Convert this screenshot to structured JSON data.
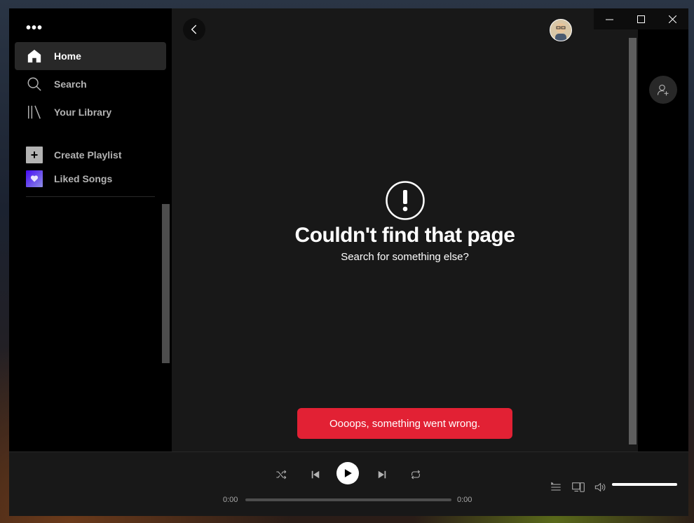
{
  "sidebar": {
    "menu_dots": "•••",
    "nav": [
      {
        "label": "Home",
        "icon": "home-icon",
        "active": true
      },
      {
        "label": "Search",
        "icon": "search-icon",
        "active": false
      },
      {
        "label": "Your Library",
        "icon": "library-icon",
        "active": false
      }
    ],
    "create_playlist": "Create Playlist",
    "liked_songs": "Liked Songs"
  },
  "main": {
    "error_title": "Couldn't find that page",
    "error_subtitle": "Search for something else?",
    "toast": "Oooops, something went wrong."
  },
  "player": {
    "elapsed": "0:00",
    "duration": "0:00",
    "progress": 0,
    "volume": 1.0
  },
  "colors": {
    "background": "#181818",
    "sidebar": "#000000",
    "active_nav": "#282828",
    "toast": "#e22134",
    "text_primary": "#ffffff",
    "text_secondary": "#b3b3b3"
  }
}
